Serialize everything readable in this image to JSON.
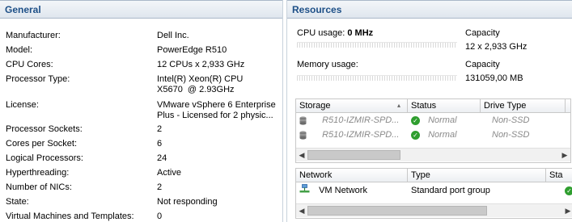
{
  "general": {
    "title": "General",
    "rows": [
      {
        "label": "Manufacturer:",
        "value": "Dell Inc."
      },
      {
        "label": "Model:",
        "value": "PowerEdge R510"
      },
      {
        "label": "CPU Cores:",
        "value": "12 CPUs x 2,933 GHz"
      },
      {
        "label": "Processor Type:",
        "value_lines": [
          "Intel(R) Xeon(R) CPU",
          "X5670  @ 2.93GHz"
        ]
      },
      {
        "label": "License:",
        "value_lines": [
          "VMware vSphere 6 Enterprise",
          "Plus - Licensed for 2 physic..."
        ]
      },
      {
        "label": "Processor Sockets:",
        "value": "2"
      },
      {
        "label": "Cores per Socket:",
        "value": "6"
      },
      {
        "label": "Logical Processors:",
        "value": "24"
      },
      {
        "label": "Hyperthreading:",
        "value": "Active"
      },
      {
        "label": "Number of NICs:",
        "value": "2"
      },
      {
        "label": "State:",
        "value": "Not responding"
      },
      {
        "label": "Virtual Machines and Templates:",
        "value": "0"
      }
    ]
  },
  "resources": {
    "title": "Resources",
    "cpu": {
      "label": "CPU usage:",
      "value": "0 MHz",
      "capacity_label": "Capacity",
      "capacity": "12 x 2,933 GHz"
    },
    "memory": {
      "label": "Memory usage:",
      "capacity_label": "Capacity",
      "capacity": "131059,00 MB"
    },
    "storage": {
      "columns": [
        "Storage",
        "Status",
        "Drive Type"
      ],
      "rows": [
        {
          "name": "R510-IZMIR-SPD...",
          "status": "Normal",
          "drive_type": "Non-SSD",
          "icon": "datastore-icon",
          "status_icon": "ok-icon"
        },
        {
          "name": "R510-IZMIR-SPD...",
          "status": "Normal",
          "drive_type": "Non-SSD",
          "icon": "datastore-icon",
          "status_icon": "ok-icon"
        }
      ]
    },
    "network": {
      "columns": [
        "Network",
        "Type",
        "Sta"
      ],
      "rows": [
        {
          "name": "VM Network",
          "type": "Standard port group",
          "icon": "network-icon",
          "status_icon": "ok-icon"
        }
      ]
    }
  }
}
